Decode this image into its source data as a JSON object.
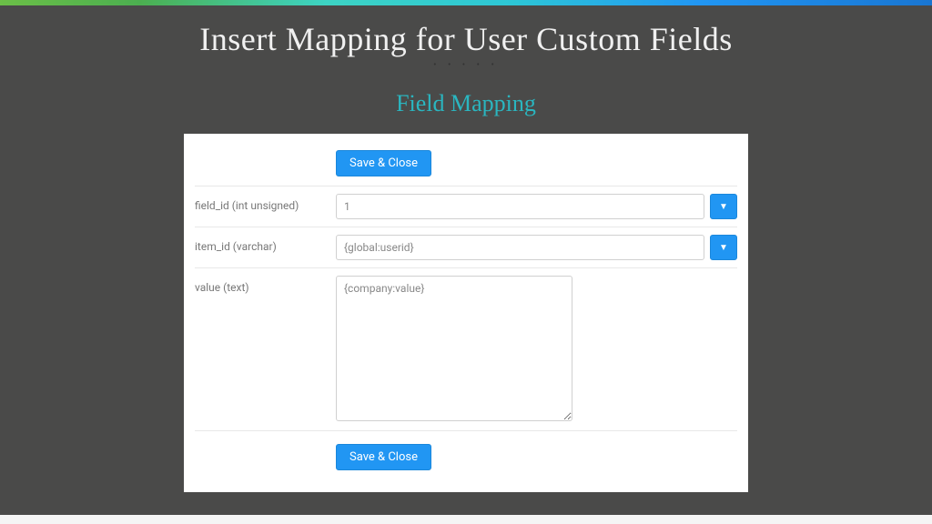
{
  "header": {
    "page_title": "Insert Mapping for User Custom Fields",
    "subtitle": "Field Mapping"
  },
  "form": {
    "save_button_label": "Save & Close",
    "fields": [
      {
        "label": "field_id (int unsigned)",
        "value": "1",
        "has_dropdown": true,
        "type": "text"
      },
      {
        "label": "item_id (varchar)",
        "value": "{global:userid}",
        "has_dropdown": true,
        "type": "text"
      },
      {
        "label": "value (text)",
        "value": "{company:value}",
        "has_dropdown": false,
        "type": "textarea"
      }
    ]
  },
  "colors": {
    "accent_blue": "#2196f3",
    "subtitle_teal": "#2ab6c0",
    "dark_bg": "#4a4a49"
  }
}
